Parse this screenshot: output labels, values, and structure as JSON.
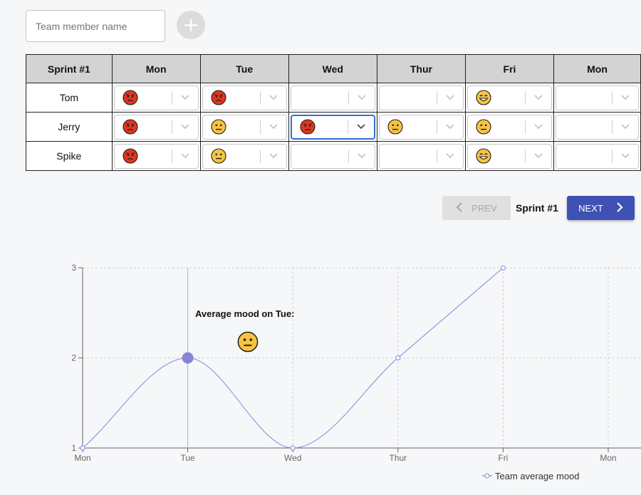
{
  "toolbar": {
    "name_placeholder": "Team member name",
    "add_label": "+"
  },
  "table": {
    "sprint_header": "Sprint #1",
    "days": [
      "Mon",
      "Tue",
      "Wed",
      "Thur",
      "Fri",
      "Mon"
    ],
    "rows": [
      {
        "name": "Tom",
        "moods": [
          "angry",
          "angry",
          "",
          "",
          "happy",
          ""
        ]
      },
      {
        "name": "Jerry",
        "moods": [
          "angry",
          "neutral",
          "angry",
          "neutral",
          "neutral",
          ""
        ]
      },
      {
        "name": "Spike",
        "moods": [
          "angry",
          "neutral",
          "",
          "",
          "happy",
          ""
        ]
      }
    ],
    "focused_cell": {
      "row": 1,
      "col": 2
    }
  },
  "pagination": {
    "prev_label": "PREV",
    "sprint_label": "Sprint #1",
    "next_label": "NEXT",
    "prev_disabled": true
  },
  "tooltip": {
    "text": "Average mood on Tue:",
    "mood": "neutral"
  },
  "colors": {
    "accent": "#3f51b5",
    "line": "#8884d8",
    "angry": "#e0351f",
    "neutral": "#f6c342",
    "happy": "#f6c342",
    "focus": "#2f6fd8"
  },
  "chart_data": {
    "type": "line",
    "categories": [
      "Mon",
      "Tue",
      "Wed",
      "Thur",
      "Fri",
      "Mon"
    ],
    "series": [
      {
        "name": "Team average mood",
        "values": [
          1,
          2,
          1,
          2,
          3,
          null
        ]
      }
    ],
    "ylim": [
      1,
      3
    ],
    "yticks": [
      1,
      2,
      3
    ],
    "grid": true,
    "legend": "bottom-right",
    "active_index": 1
  }
}
